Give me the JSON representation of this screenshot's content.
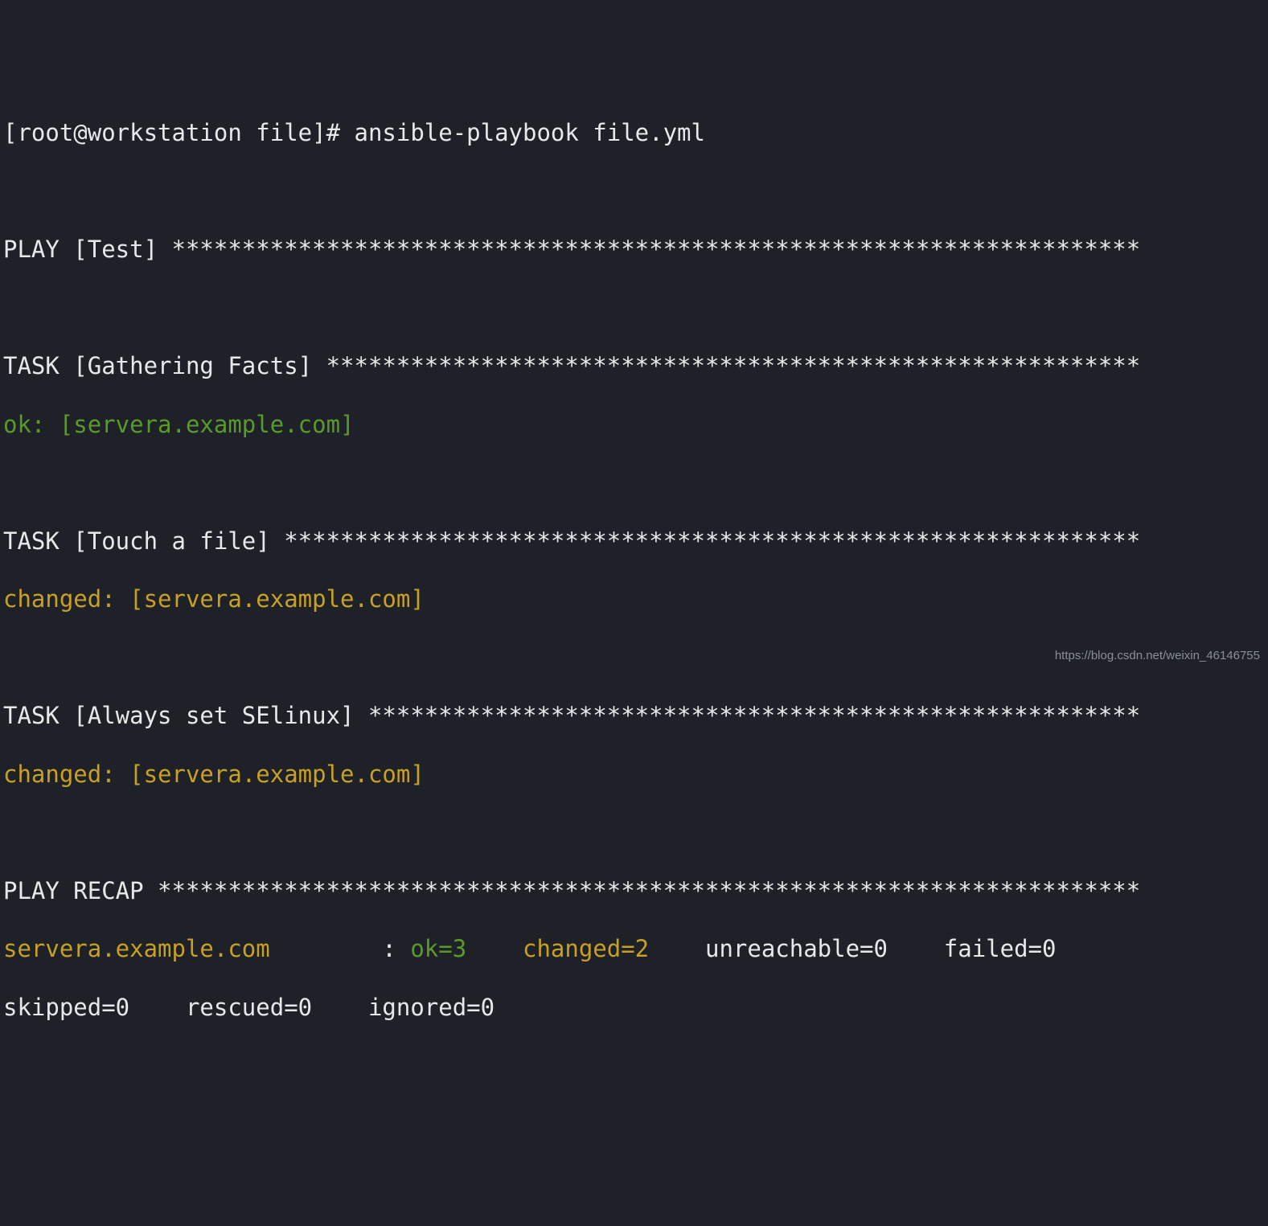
{
  "prompt": "[root@workstation file]# ansible-playbook file.yml",
  "play_header": "PLAY [Test] *********************************************************************",
  "task1_header": "TASK [Gathering Facts] **********************************************************",
  "task1_result": "ok: [servera.example.com]",
  "task2_header": "TASK [Touch a file] *************************************************************",
  "task2_result": "changed: [servera.example.com]",
  "task3_header": "TASK [Always set SElinux] *******************************************************",
  "task3_result": "changed: [servera.example.com]",
  "recap_header": "PLAY RECAP **********************************************************************",
  "recap": {
    "host_padded": "servera.example.com        ",
    "sep": ": ",
    "ok": "ok=3   ",
    "changed": " changed=2   ",
    "unreachable": " unreachable=0   ",
    "failed": " failed=0    ",
    "line2": "skipped=0    rescued=0    ignored=0"
  },
  "watermark": "https://blog.csdn.net/weixin_46146755"
}
